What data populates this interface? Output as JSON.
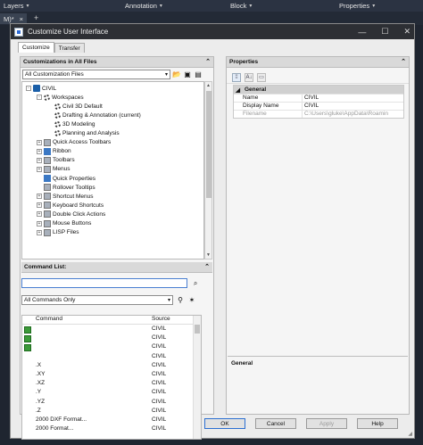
{
  "ribbon": {
    "items": [
      "Layers",
      "Annotation",
      "Block",
      "Properties"
    ],
    "tab_label": "M)*",
    "tab_close": "×",
    "tab_add": "+"
  },
  "dialog": {
    "title": "Customize User Interface",
    "tabs": [
      "Customize",
      "Transfer"
    ],
    "minimize": "—",
    "maximize": "☐",
    "close": "✕"
  },
  "customizations": {
    "header": "Customizations in All Files",
    "filter_value": "All Customization Files",
    "tree": [
      {
        "label": "CIVIL",
        "level": 0,
        "icon": "civil-icon",
        "expander": "-"
      },
      {
        "label": "Workspaces",
        "level": 1,
        "icon": "gear-icon",
        "expander": "-"
      },
      {
        "label": "Civil 3D Default",
        "level": 2,
        "icon": "gear-icon",
        "expander": ""
      },
      {
        "label": "Drafting & Annotation (current)",
        "level": 2,
        "icon": "gear-icon",
        "expander": ""
      },
      {
        "label": "3D Modeling",
        "level": 2,
        "icon": "gear-icon",
        "expander": ""
      },
      {
        "label": "Planning and Analysis",
        "level": 2,
        "icon": "gear-icon",
        "expander": ""
      },
      {
        "label": "Quick Access Toolbars",
        "level": 1,
        "icon": "toolbar-icon",
        "expander": "+"
      },
      {
        "label": "Ribbon",
        "level": 1,
        "icon": "ribbon-icon",
        "expander": "+"
      },
      {
        "label": "Toolbars",
        "level": 1,
        "icon": "toolbar-icon",
        "expander": "+"
      },
      {
        "label": "Menus",
        "level": 1,
        "icon": "menu-icon",
        "expander": "+"
      },
      {
        "label": "Quick Properties",
        "level": 1,
        "icon": "properties-icon",
        "expander": ""
      },
      {
        "label": "Rollover Tooltips",
        "level": 1,
        "icon": "tooltip-icon",
        "expander": ""
      },
      {
        "label": "Shortcut Menus",
        "level": 1,
        "icon": "menu-icon",
        "expander": "+"
      },
      {
        "label": "Keyboard Shortcuts",
        "level": 1,
        "icon": "keyboard-icon",
        "expander": "+"
      },
      {
        "label": "Double Click Actions",
        "level": 1,
        "icon": "mouse-icon",
        "expander": "+"
      },
      {
        "label": "Mouse Buttons",
        "level": 1,
        "icon": "mouse-icon",
        "expander": "+"
      },
      {
        "label": "LISP Files",
        "level": 1,
        "icon": "lisp-icon",
        "expander": "+"
      }
    ]
  },
  "command_list": {
    "header": "Command List:",
    "search_value": "",
    "filter_value": "All Commands Only",
    "columns": [
      "Command",
      "Source"
    ],
    "rows": [
      {
        "command": "",
        "source": "CIVIL",
        "has_icon": true
      },
      {
        "command": "",
        "source": "CIVIL",
        "has_icon": true
      },
      {
        "command": "",
        "source": "CIVIL",
        "has_icon": true
      },
      {
        "command": "",
        "source": "CIVIL",
        "has_icon": false
      },
      {
        "command": ".X",
        "source": "CIVIL",
        "has_icon": false
      },
      {
        "command": ".XY",
        "source": "CIVIL",
        "has_icon": false
      },
      {
        "command": ".XZ",
        "source": "CIVIL",
        "has_icon": false
      },
      {
        "command": ".Y",
        "source": "CIVIL",
        "has_icon": false
      },
      {
        "command": ".YZ",
        "source": "CIVIL",
        "has_icon": false
      },
      {
        "command": ".Z",
        "source": "CIVIL",
        "has_icon": false
      },
      {
        "command": "2000 DXF Format...",
        "source": "CIVIL",
        "has_icon": false
      },
      {
        "command": "2000 Format...",
        "source": "CIVIL",
        "has_icon": false
      }
    ]
  },
  "properties": {
    "header": "Properties",
    "category": "General",
    "rows": [
      {
        "name": "Name",
        "value": "CIVIL",
        "dim": false
      },
      {
        "name": "Display Name",
        "value": "CIVIL",
        "dim": false
      },
      {
        "name": "Filename",
        "value": "C:\\Users\\gluke\\AppData\\Roamin",
        "dim": true
      }
    ],
    "description_label": "General"
  },
  "buttons": {
    "ok": "OK",
    "cancel": "Cancel",
    "apply": "Apply",
    "help": "Help"
  }
}
